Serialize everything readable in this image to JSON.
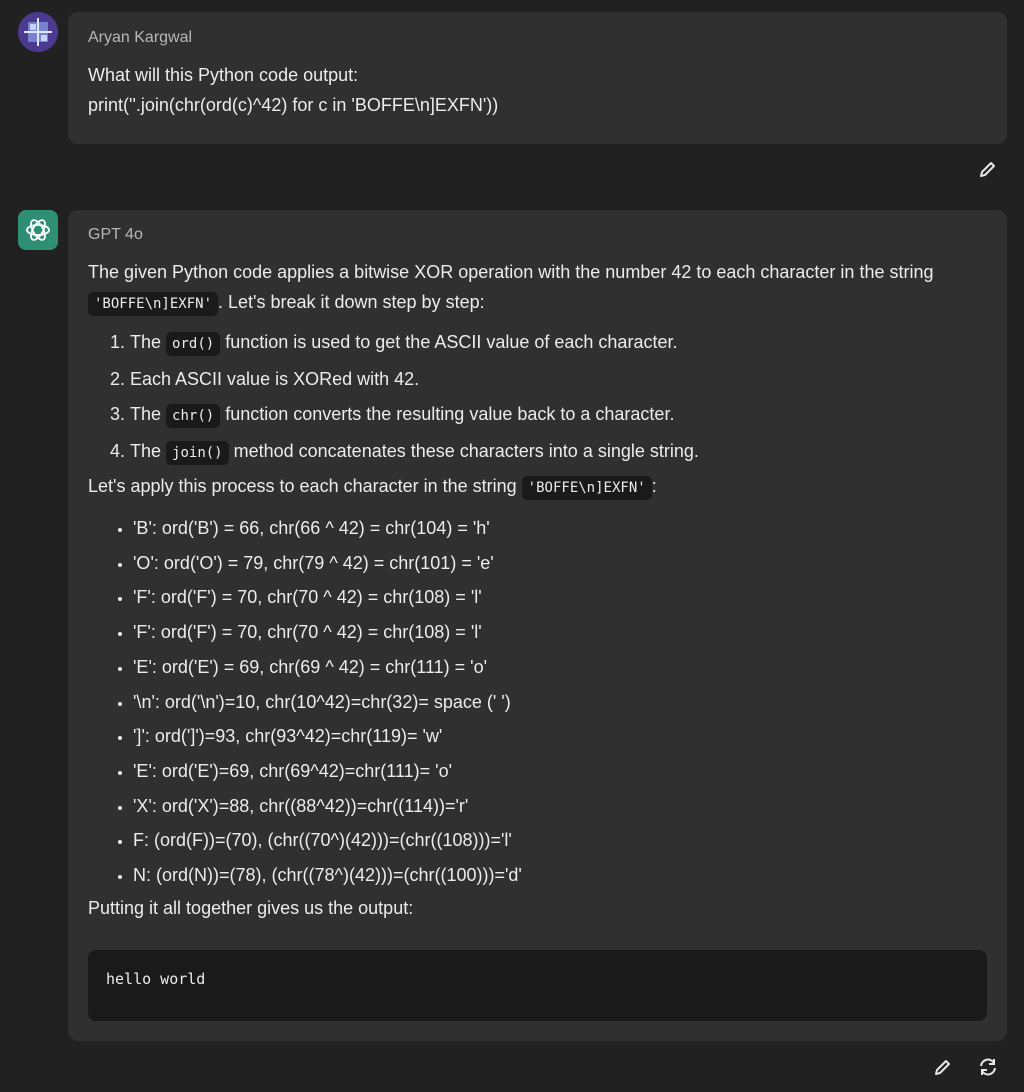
{
  "user_message": {
    "author": "Aryan Kargwal",
    "lines": [
      "What will this Python code output:",
      "print(''.join(chr(ord(c)^42) for c in 'BOFFE\\n]EXFN'))"
    ]
  },
  "assistant_message": {
    "author": "GPT 4o",
    "intro_pre": "The given Python code applies a bitwise XOR operation with the number 42 to each character in the string ",
    "intro_code": "'BOFFE\\n]EXFN'",
    "intro_post": ". Let's break it down step by step:",
    "steps": [
      {
        "pre": "The ",
        "code": "ord()",
        "post": " function is used to get the ASCII value of each character."
      },
      {
        "pre": "Each ASCII value is XORed with 42.",
        "code": "",
        "post": ""
      },
      {
        "pre": "The ",
        "code": "chr()",
        "post": " function converts the resulting value back to a character."
      },
      {
        "pre": "The ",
        "code": "join()",
        "post": " method concatenates these characters into a single string."
      }
    ],
    "apply_pre": "Let's apply this process to each character in the string ",
    "apply_code": "'BOFFE\\n]EXFN'",
    "apply_post": ":",
    "bullets": [
      "'B': ord('B') = 66, chr(66 ^ 42) = chr(104) = 'h'",
      "'O': ord('O') = 79, chr(79 ^ 42) = chr(101) = 'e'",
      "'F': ord('F') = 70, chr(70 ^ 42) = chr(108) = 'l'",
      "'F': ord('F') = 70, chr(70 ^ 42) = chr(108) = 'l'",
      "'E': ord('E') = 69, chr(69 ^ 42) = chr(111) = 'o'",
      "'\\n': ord('\\n')=10, chr(10^42)=chr(32)= space (' ')",
      "']': ord(']')=93, chr(93^42)=chr(119)= 'w'",
      "'E': ord('E')=69, chr(69^42)=chr(111)= 'o'",
      "'X': ord('X')=88, chr((88^42))=chr((114))='r'",
      "F: (ord(F))=(70), (chr((70^)(42)))=(chr((108)))='l'",
      "N: (ord(N))=(78), (chr((78^)(42)))=(chr((100)))='d'"
    ],
    "conclusion": "Putting it all together gives us the output:",
    "output_code": "hello world"
  },
  "icons": {
    "edit_user": "pencil-icon",
    "edit_assistant": "pencil-icon",
    "regenerate": "refresh-icon"
  },
  "colors": {
    "background": "#212121",
    "bubble": "#303030",
    "code_bg": "#1a1a1a",
    "gpt_avatar": "#2f8f74"
  }
}
